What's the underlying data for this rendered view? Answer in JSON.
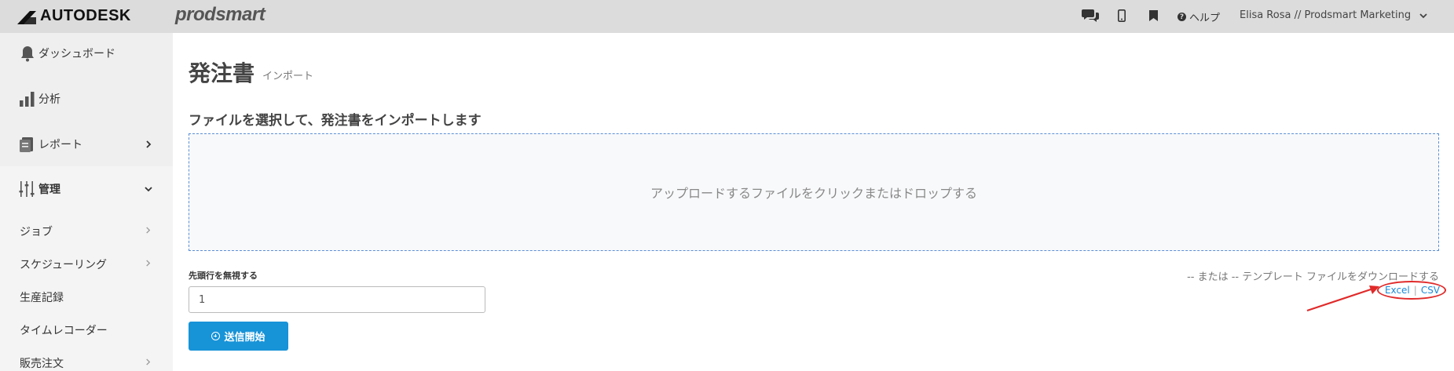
{
  "header": {
    "autodesk_brand": "AUTODESK",
    "prodsmart_brand": "prodsmart",
    "icons": [
      "chat-icon",
      "mobile-icon",
      "bookmark-icon"
    ],
    "help_label": "ヘルプ",
    "user_label": "Elisa Rosa // Prodsmart Marketing"
  },
  "sidebar": {
    "items": [
      {
        "label": "ダッシュボード",
        "icon": "bell-icon"
      },
      {
        "label": "分析",
        "icon": "bar-chart-icon"
      },
      {
        "label": "レポート",
        "icon": "report-icon"
      },
      {
        "label": "管理",
        "icon": "sliders-icon"
      }
    ],
    "subitems": [
      {
        "label": "ジョブ"
      },
      {
        "label": "スケジューリング"
      },
      {
        "label": "生産記録"
      },
      {
        "label": "タイムレコーダー"
      },
      {
        "label": "販売注文"
      }
    ]
  },
  "main": {
    "title": "発注書",
    "subtitle": "インポート",
    "heading": "ファイルを選択して、発注書をインポートします",
    "dropzone_text": "アップロードするファイルをクリックまたはドロップする",
    "skip_rows_label": "先頭行を無視する",
    "skip_rows_value": "1",
    "submit_label": "送信開始",
    "template_text": "-- または -- テンプレート ファイルをダウンロードする",
    "template_excel": "Excel",
    "template_sep": "|",
    "template_csv": "CSV"
  },
  "colors": {
    "topbar": "#dcdcdc",
    "sidebar": "#efefef",
    "accent": "#1793d8",
    "link": "#1c8ad8",
    "annotation": "#e02a2a",
    "dropzone_border": "#5b8fd6"
  }
}
